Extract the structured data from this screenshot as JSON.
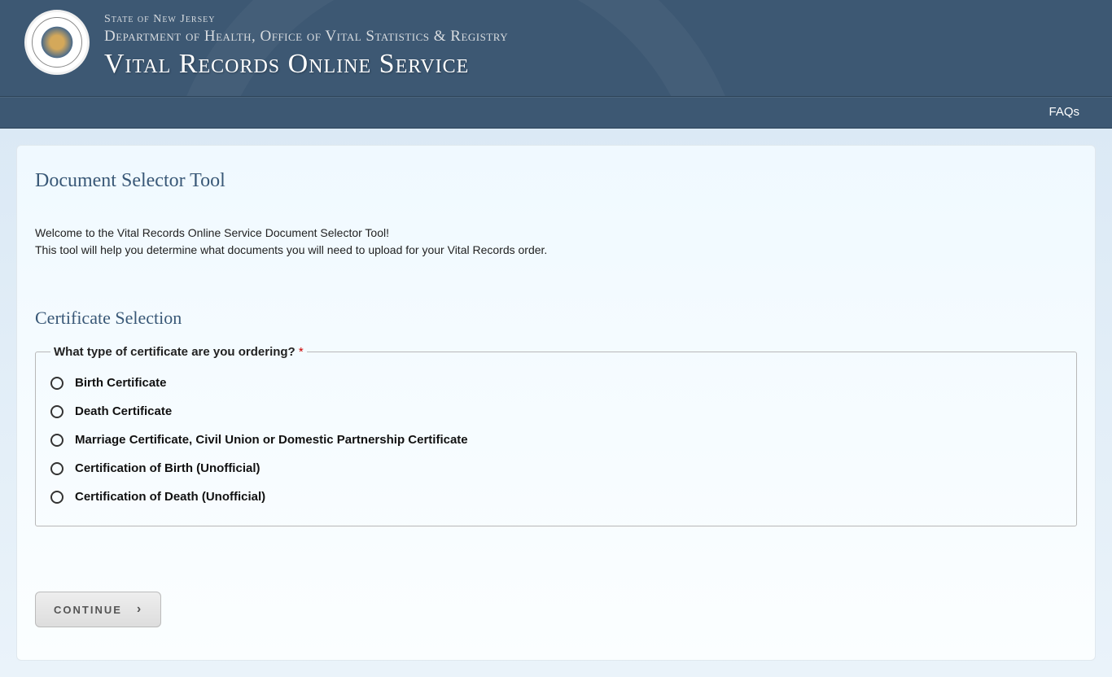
{
  "header": {
    "state": "State of New Jersey",
    "dept": "Department of Health, Office of Vital Statistics & Registry",
    "service": "Vital Records Online Service"
  },
  "nav": {
    "faqs": "FAQs"
  },
  "page": {
    "title": "Document Selector Tool",
    "intro_line1": "Welcome to the Vital Records Online Service Document Selector Tool!",
    "intro_line2": "This tool will help you determine what documents you will need to upload for your Vital Records order.",
    "section_title": "Certificate Selection",
    "fieldset_legend": "What type of certificate are you ordering?",
    "required_mark": "*",
    "options": [
      "Birth Certificate",
      "Death Certificate",
      "Marriage Certificate, Civil Union or Domestic Partnership Certificate",
      "Certification of Birth (Unofficial)",
      "Certification of Death (Unofficial)"
    ],
    "continue_label": "CONTINUE"
  }
}
